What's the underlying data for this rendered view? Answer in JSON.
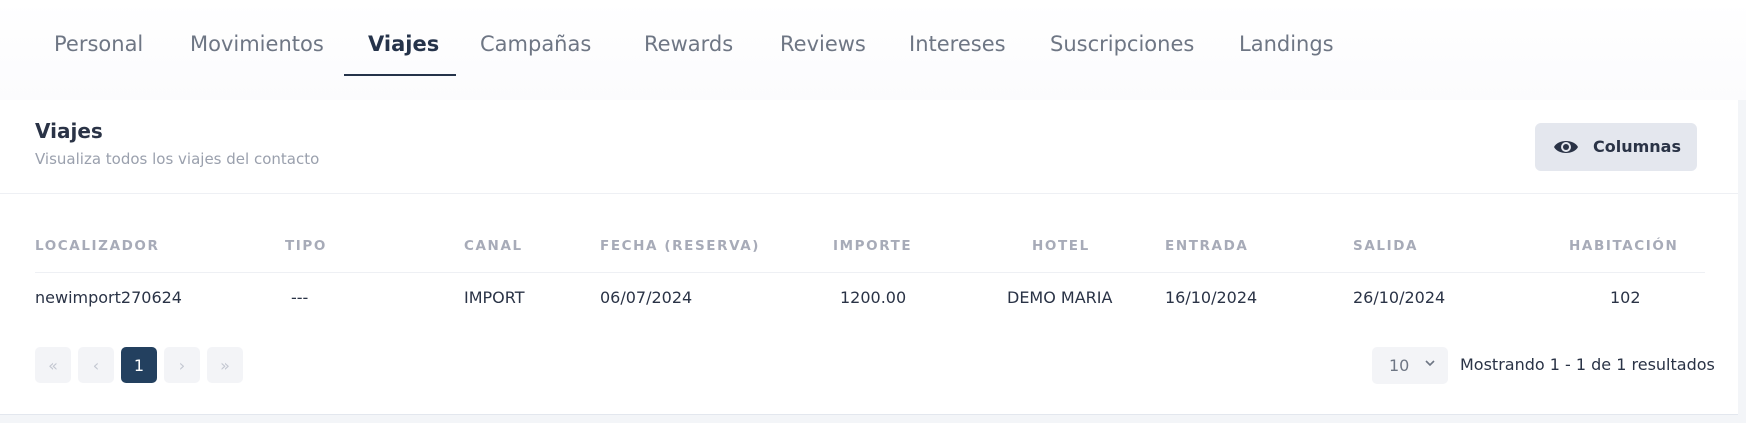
{
  "tabs": [
    {
      "label": "Personal"
    },
    {
      "label": "Movimientos"
    },
    {
      "label": "Viajes"
    },
    {
      "label": "Campañas"
    },
    {
      "label": "Rewards"
    },
    {
      "label": "Reviews"
    },
    {
      "label": "Intereses"
    },
    {
      "label": "Suscripciones"
    },
    {
      "label": "Landings"
    }
  ],
  "active_tab": "Viajes",
  "card": {
    "title": "Viajes",
    "subtitle": "Visualiza todos los viajes del contacto",
    "columns_button": "Columnas",
    "columns_icon": "eye-icon"
  },
  "table": {
    "headers": [
      "LOCALIZADOR",
      "TIPO",
      "CANAL",
      "FECHA (RESERVA)",
      "IMPORTE",
      "HOTEL",
      "ENTRADA",
      "SALIDA",
      "HABITACIÓN"
    ],
    "rows": [
      [
        "newimport270624",
        "---",
        "IMPORT",
        "06/07/2024",
        "1200.00",
        "DEMO MARIA",
        "16/10/2024",
        "26/10/2024",
        "102"
      ]
    ]
  },
  "pagination": {
    "first": "«",
    "prev": "‹",
    "current": "1",
    "next": "›",
    "last": "»",
    "per_page": "10",
    "results_text": "Mostrando 1 - 1 de 1 resultados"
  },
  "colors": {
    "accent": "#25334a",
    "active_page": "#23405f"
  }
}
